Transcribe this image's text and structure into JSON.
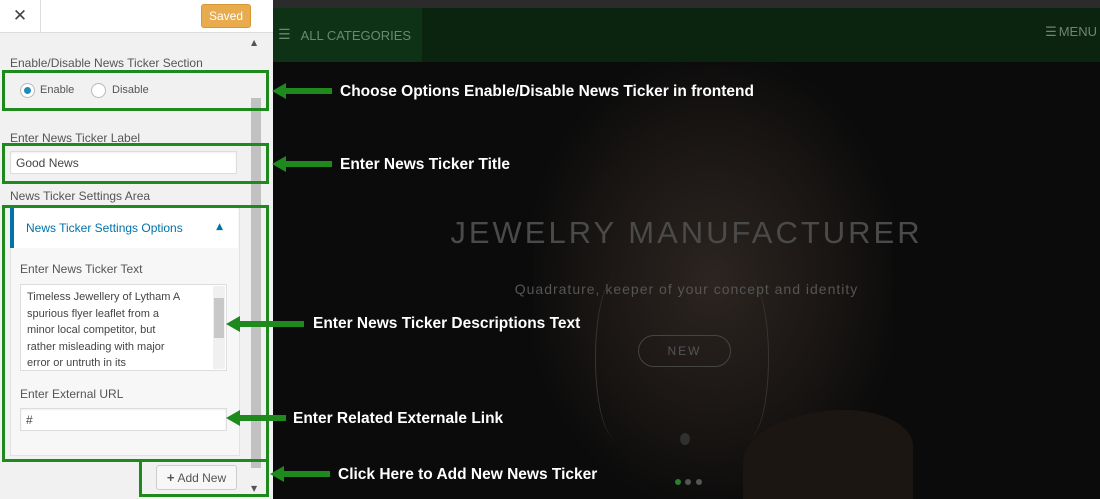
{
  "panel": {
    "close_icon": "close-icon",
    "saved_label": "Saved",
    "enable_section_title": "Enable/Disable News Ticker Section",
    "radio_enable": "Enable",
    "radio_disable": "Disable",
    "label_title": "Enter News Ticker Label",
    "label_value": "Good News",
    "settings_area_title": "News Ticker Settings Area",
    "settings_options_title": "News Ticker Settings Options",
    "ticker_text_label": "Enter News Ticker Text",
    "ticker_text_value": "Timeless Jewellery of Lytham A\nspurious flyer leaflet from a\nminor local competitor, but\nrather misleading with major\nerror or untruth in its",
    "external_url_label": "Enter External URL",
    "external_url_value": "#",
    "add_new_label": "Add New"
  },
  "preview": {
    "all_categories": "ALL CATEGORIES",
    "menu_label": "MENU",
    "hero_title": "JEWELRY MANUFACTURER",
    "hero_subtitle": "Quadrature, keeper of your concept and identity",
    "hero_button": "NEW"
  },
  "annotations": {
    "a1": "Choose Options Enable/Disable News Ticker in frontend",
    "a2": "Enter News Ticker Title",
    "a3": "Enter News Ticker Descriptions Text",
    "a4": "Enter Related Externale Link",
    "a5": "Click Here to Add New News Ticker"
  },
  "colors": {
    "highlight": "#1e8a1e",
    "accent_blue": "#0073aa",
    "saved_orange": "#e6a23a"
  }
}
